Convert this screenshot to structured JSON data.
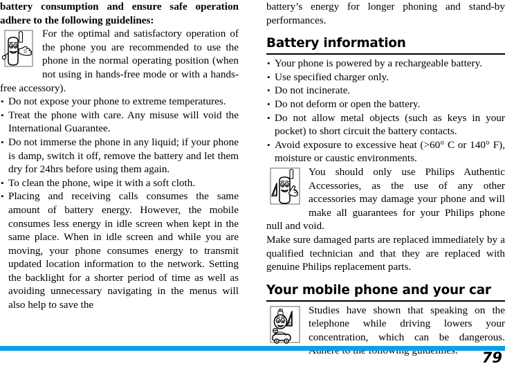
{
  "document": {
    "page_number": "79",
    "accent_color": "#0CA0E8",
    "rule_color": "#000000"
  },
  "left_column": {
    "intro_paragraph": "battery consumption and ensure safe operation adhere to the following guidelines:",
    "figure": {
      "icon_name": "phone-character-pointing-icon",
      "text": "For the optimal and satisfactory operation of the phone you are recommended to use the phone in the normal operating position (when not using in hands-free mode or with a hands-free accessory)."
    },
    "bullets": [
      "Do not expose your phone to extreme temperatures.",
      "Treat the phone with care. Any misuse will void the International Guarantee.",
      "Do not immerse the phone in any liquid; if your phone is damp, switch it off, remove the battery and let them dry for 24hrs before using them again.",
      "To clean the phone, wipe it with a soft cloth.",
      "Placing and receiving calls consumes the same amount of battery energy. However, the mobile consumes less energy in idle screen when kept in the same place. When in idle screen and while you are moving, your phone consumes energy to transmit updated location information to the network. Setting the backlight for a shorter period of time as well as avoiding unnecessary navigating in the menus will also help to save the"
    ]
  },
  "right_column": {
    "continued_paragraph": "battery’s energy for longer phoning and stand-by performances.",
    "sections": [
      {
        "heading": "Battery information",
        "bullets": [
          "Your phone is powered by a rechargeable battery.",
          "Use specified charger only.",
          "Do not incinerate.",
          "Do not deform or open the battery.",
          "Do not allow metal objects (such as keys in your pocket) to short circuit the battery contacts.",
          "Avoid exposure to excessive heat (>60° C or 140° F), moisture or caustic environments."
        ],
        "figure": {
          "icon_name": "phone-character-warning-pointing-icon",
          "text": "You should only use Philips Authentic Accessories, as the use of any other accessories may damage your phone and will make all guarantees for your Philips phone null and void."
        },
        "closing_paragraph": "Make sure damaged parts are replaced immediately by a qualified technician and that they are replaced with genuine Philips replacement parts."
      },
      {
        "heading": "Your mobile phone and your car",
        "figure": {
          "icon_name": "phone-character-driving-car-warning-icon",
          "text": "Studies have shown that speaking on the telephone while driving lowers your concentration, which can be dangerous. Adhere to the following guidelines:"
        }
      }
    ]
  }
}
